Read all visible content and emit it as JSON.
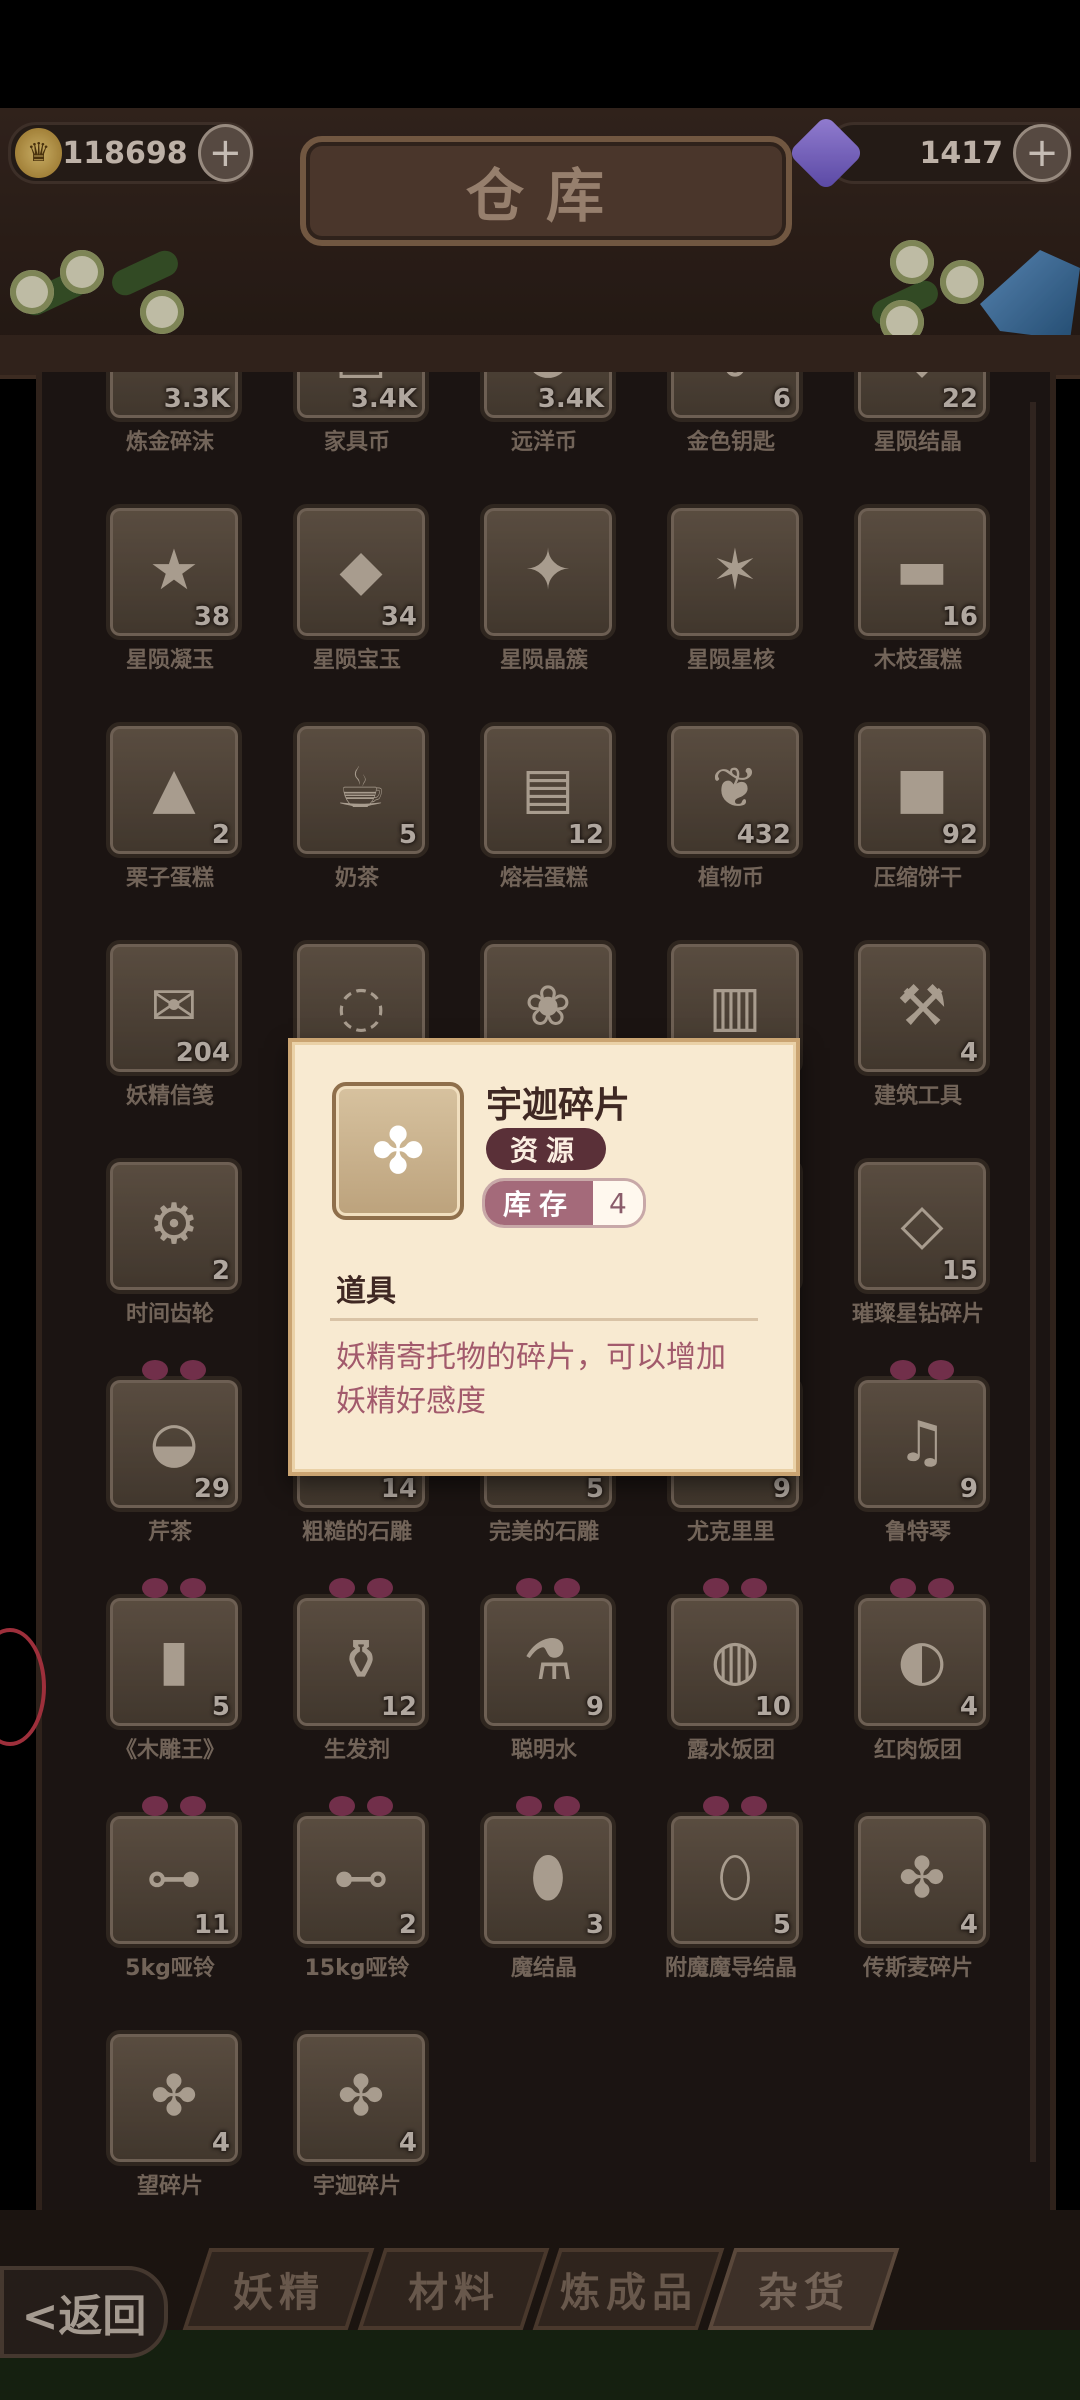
{
  "header": {
    "title": "仓库",
    "coins": "118698",
    "gems": "1417"
  },
  "items": [
    {
      "name": "炼金碎沫",
      "count": "3.3K",
      "icon": "dust-icon",
      "glyph": "✦"
    },
    {
      "name": "家具币",
      "count": "3.4K",
      "icon": "furniture-coin-icon",
      "glyph": "▣"
    },
    {
      "name": "远洋币",
      "count": "3.4K",
      "icon": "ocean-coin-icon",
      "glyph": "●"
    },
    {
      "name": "金色钥匙",
      "count": "6",
      "icon": "golden-key-icon",
      "glyph": "⚷"
    },
    {
      "name": "星陨结晶",
      "count": "22",
      "icon": "star-crystal-icon",
      "glyph": "◆"
    },
    {
      "name": "星陨凝玉",
      "count": "38",
      "icon": "star-jade-icon",
      "glyph": "★"
    },
    {
      "name": "星陨宝玉",
      "count": "34",
      "icon": "star-gem-icon",
      "glyph": "◆"
    },
    {
      "name": "星陨晶簇",
      "count": "",
      "icon": "star-cluster-icon",
      "glyph": "✦"
    },
    {
      "name": "星陨星核",
      "count": "",
      "icon": "star-core-icon",
      "glyph": "✶"
    },
    {
      "name": "木枝蛋糕",
      "count": "16",
      "icon": "log-cake-icon",
      "glyph": "▬"
    },
    {
      "name": "栗子蛋糕",
      "count": "2",
      "icon": "chestnut-cake-icon",
      "glyph": "▲"
    },
    {
      "name": "奶茶",
      "count": "5",
      "icon": "milk-tea-icon",
      "glyph": "☕"
    },
    {
      "name": "熔岩蛋糕",
      "count": "12",
      "icon": "lava-cake-icon",
      "glyph": "▤"
    },
    {
      "name": "植物币",
      "count": "432",
      "icon": "plant-coin-icon",
      "glyph": "❦"
    },
    {
      "name": "压缩饼干",
      "count": "92",
      "icon": "biscuit-icon",
      "glyph": "■"
    },
    {
      "name": "妖精信笺",
      "count": "204",
      "icon": "fairy-letter-icon",
      "glyph": "✉"
    },
    {
      "name": "",
      "count": "",
      "icon": "item-icon",
      "glyph": "◌"
    },
    {
      "name": "",
      "count": "",
      "icon": "item-icon",
      "glyph": "❀"
    },
    {
      "name": "",
      "count": "",
      "icon": "item-icon",
      "glyph": "▥"
    },
    {
      "name": "建筑工具",
      "count": "4",
      "icon": "hammer-icon",
      "glyph": "⚒"
    },
    {
      "name": "时间齿轮",
      "count": "2",
      "icon": "gear-icon",
      "glyph": "⚙"
    },
    {
      "name": "",
      "count": "",
      "icon": "item-icon",
      "glyph": ""
    },
    {
      "name": "",
      "count": "",
      "icon": "item-icon",
      "glyph": ""
    },
    {
      "name": "",
      "count": "",
      "icon": "item-icon",
      "glyph": ""
    },
    {
      "name": "璀璨星钻碎片",
      "count": "15",
      "icon": "diamond-shard-icon",
      "glyph": "◇"
    },
    {
      "name": "芹茶",
      "count": "29",
      "icon": "tea-bowl-icon",
      "glyph": "◒",
      "bow": true
    },
    {
      "name": "粗糙的石雕",
      "count": "14",
      "icon": "rough-statue-icon",
      "glyph": "▧",
      "bow": true
    },
    {
      "name": "完美的石雕",
      "count": "5",
      "icon": "perfect-statue-icon",
      "glyph": "▨",
      "bow": true
    },
    {
      "name": "尤克里里",
      "count": "9",
      "icon": "ukulele-icon",
      "glyph": "♪",
      "bow": true
    },
    {
      "name": "鲁特琴",
      "count": "9",
      "icon": "lute-icon",
      "glyph": "♫",
      "bow": true
    },
    {
      "name": "《木雕王》",
      "count": "5",
      "icon": "book-icon",
      "glyph": "▮",
      "bow": true
    },
    {
      "name": "生发剂",
      "count": "12",
      "icon": "bottle-icon",
      "glyph": "⚱",
      "bow": true
    },
    {
      "name": "聪明水",
      "count": "9",
      "icon": "potion-icon",
      "glyph": "⚗",
      "bow": true
    },
    {
      "name": "露水饭团",
      "count": "10",
      "icon": "rice-ball-icon",
      "glyph": "◍",
      "bow": true
    },
    {
      "name": "红肉饭团",
      "count": "4",
      "icon": "meat-rice-ball-icon",
      "glyph": "◐",
      "bow": true
    },
    {
      "name": "5kg哑铃",
      "count": "11",
      "icon": "dumbbell-icon",
      "glyph": "⊶",
      "bow": true
    },
    {
      "name": "15kg哑铃",
      "count": "2",
      "icon": "heavy-dumbbell-icon",
      "glyph": "⊷",
      "bow": true
    },
    {
      "name": "魔结晶",
      "count": "3",
      "icon": "magic-crystal-icon",
      "glyph": "⬮",
      "bow": true
    },
    {
      "name": "附魔魔导结晶",
      "count": "5",
      "icon": "enchanted-crystal-icon",
      "glyph": "⬯",
      "bow": true
    },
    {
      "name": "传斯麦碎片",
      "count": "4",
      "icon": "puzzle-shard-icon",
      "glyph": "✤"
    },
    {
      "name": "望碎片",
      "count": "4",
      "icon": "puzzle-shard-icon",
      "glyph": "✤"
    },
    {
      "name": "宇迦碎片",
      "count": "4",
      "icon": "puzzle-shard-icon",
      "glyph": "✤"
    }
  ],
  "tabs": [
    {
      "label": "妖精"
    },
    {
      "label": "材料"
    },
    {
      "label": "炼成品"
    },
    {
      "label": "杂货",
      "active": true
    }
  ],
  "back_label": "<返回",
  "popup": {
    "title": "宇迦碎片",
    "type_badge": "资源",
    "stock_label": "库存",
    "stock_value": "4",
    "category": "道具",
    "description": "妖精寄托物的碎片，可以增加妖精好感度"
  }
}
